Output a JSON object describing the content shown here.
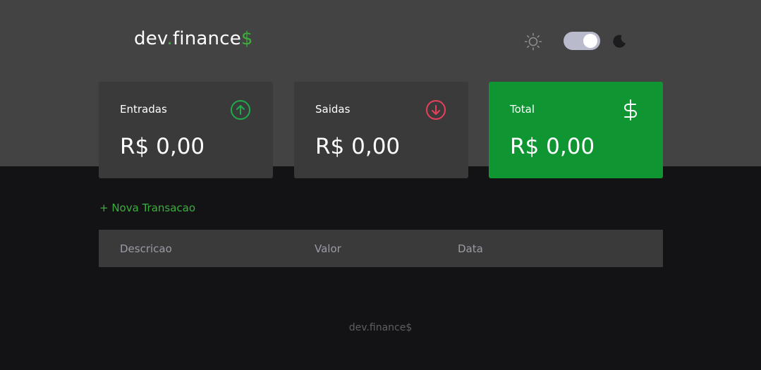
{
  "header": {
    "logo": {
      "prefix": "dev",
      "dot": ".",
      "word": "finance",
      "symbol": "$"
    },
    "theme": {
      "light_icon": "sun-icon",
      "dark_icon": "moon-icon",
      "mode": "dark"
    }
  },
  "cards": [
    {
      "label": "Entradas",
      "value": "R$ 0,00",
      "icon": "arrow-up-circle-icon",
      "icon_color": "#1faa4c"
    },
    {
      "label": "Saidas",
      "value": "R$ 0,00",
      "icon": "arrow-down-circle-icon",
      "icon_color": "#e83f5b"
    },
    {
      "label": "Total",
      "value": "R$ 0,00",
      "icon": "dollar-sign-icon",
      "icon_color": "#ffffff"
    }
  ],
  "actions": {
    "new_transaction": "+ Nova Transacao"
  },
  "table": {
    "columns": [
      "Descricao",
      "Valor",
      "Data"
    ],
    "rows": []
  },
  "footer": {
    "text": "dev.finance$"
  },
  "colors": {
    "header_bg": "#434343",
    "page_bg": "#131315",
    "card_bg": "#3a3a3a",
    "total_bg": "#0f9632",
    "accent": "#3dae3d"
  }
}
